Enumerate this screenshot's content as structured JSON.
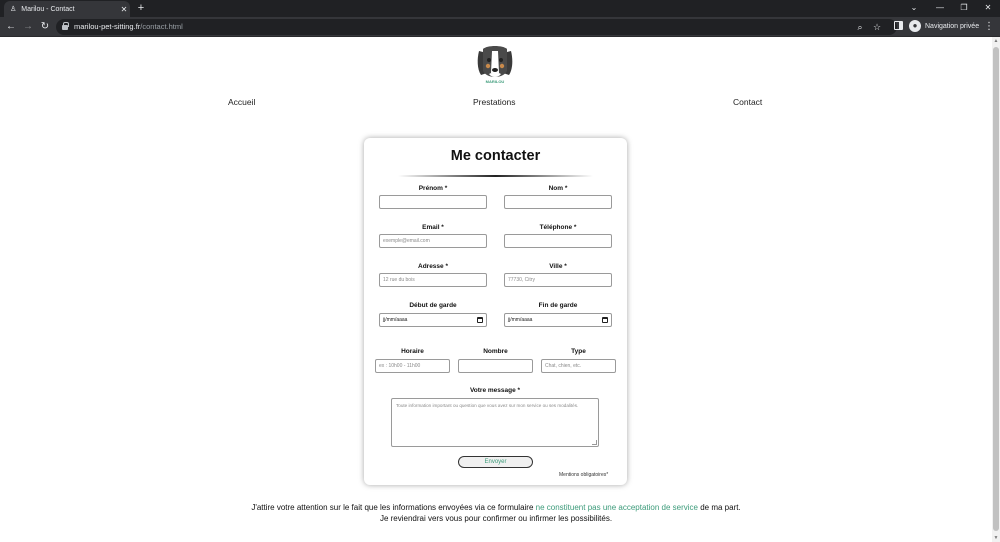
{
  "browser": {
    "tab_title": "Marilou - Contact",
    "tab_close": "✕",
    "new_tab": "+",
    "url_host": "marilou-pet-sitting.fr",
    "url_path": "/contact.html",
    "private_label": "Navigation privée",
    "controls": {
      "minimize": "—",
      "restore": "❐",
      "close": "✕",
      "chevron": "⌄"
    }
  },
  "site": {
    "logo_text": "MARILOU",
    "nav": [
      "Accueil",
      "Prestations",
      "Contact"
    ]
  },
  "form": {
    "title": "Me contacter",
    "fields": {
      "prenom": {
        "label": "Prénom *",
        "placeholder": ""
      },
      "nom": {
        "label": "Nom *",
        "placeholder": ""
      },
      "email": {
        "label": "Email *",
        "placeholder": "exemple@email.com"
      },
      "telephone": {
        "label": "Téléphone *",
        "placeholder": ""
      },
      "adresse": {
        "label": "Adresse *",
        "placeholder": "12 rue du bois"
      },
      "ville": {
        "label": "Ville *",
        "placeholder": "77730, Citry"
      },
      "debut": {
        "label": "Début de garde",
        "value": "jj/mm/aaaa"
      },
      "fin": {
        "label": "Fin de garde",
        "value": "jj/mm/aaaa"
      },
      "horaire": {
        "label": "Horaire",
        "placeholder": "ex : 10h00 - 11h00"
      },
      "nombre": {
        "label": "Nombre",
        "placeholder": ""
      },
      "type": {
        "label": "Type",
        "placeholder": "Chat, chien, etc."
      },
      "message": {
        "label": "Votre message *",
        "placeholder": "Toute information important ou question que vous avez sur mon service ou ses modalités."
      }
    },
    "submit_label": "Envoyer",
    "mandatory_note": "Mentions obligatoires*"
  },
  "notice": {
    "before": "J'attire votre attention sur le fait que les informations envoyées via ce formulaire ",
    "highlight": "ne constituent pas une acceptation de service",
    "after": " de ma part. Je reviendrai vers vous pour confirmer ou infirmer les possibilités."
  },
  "colors": {
    "accent": "#3c9b7a",
    "chrome_dark": "#202124",
    "chrome_tab": "#35363a"
  }
}
